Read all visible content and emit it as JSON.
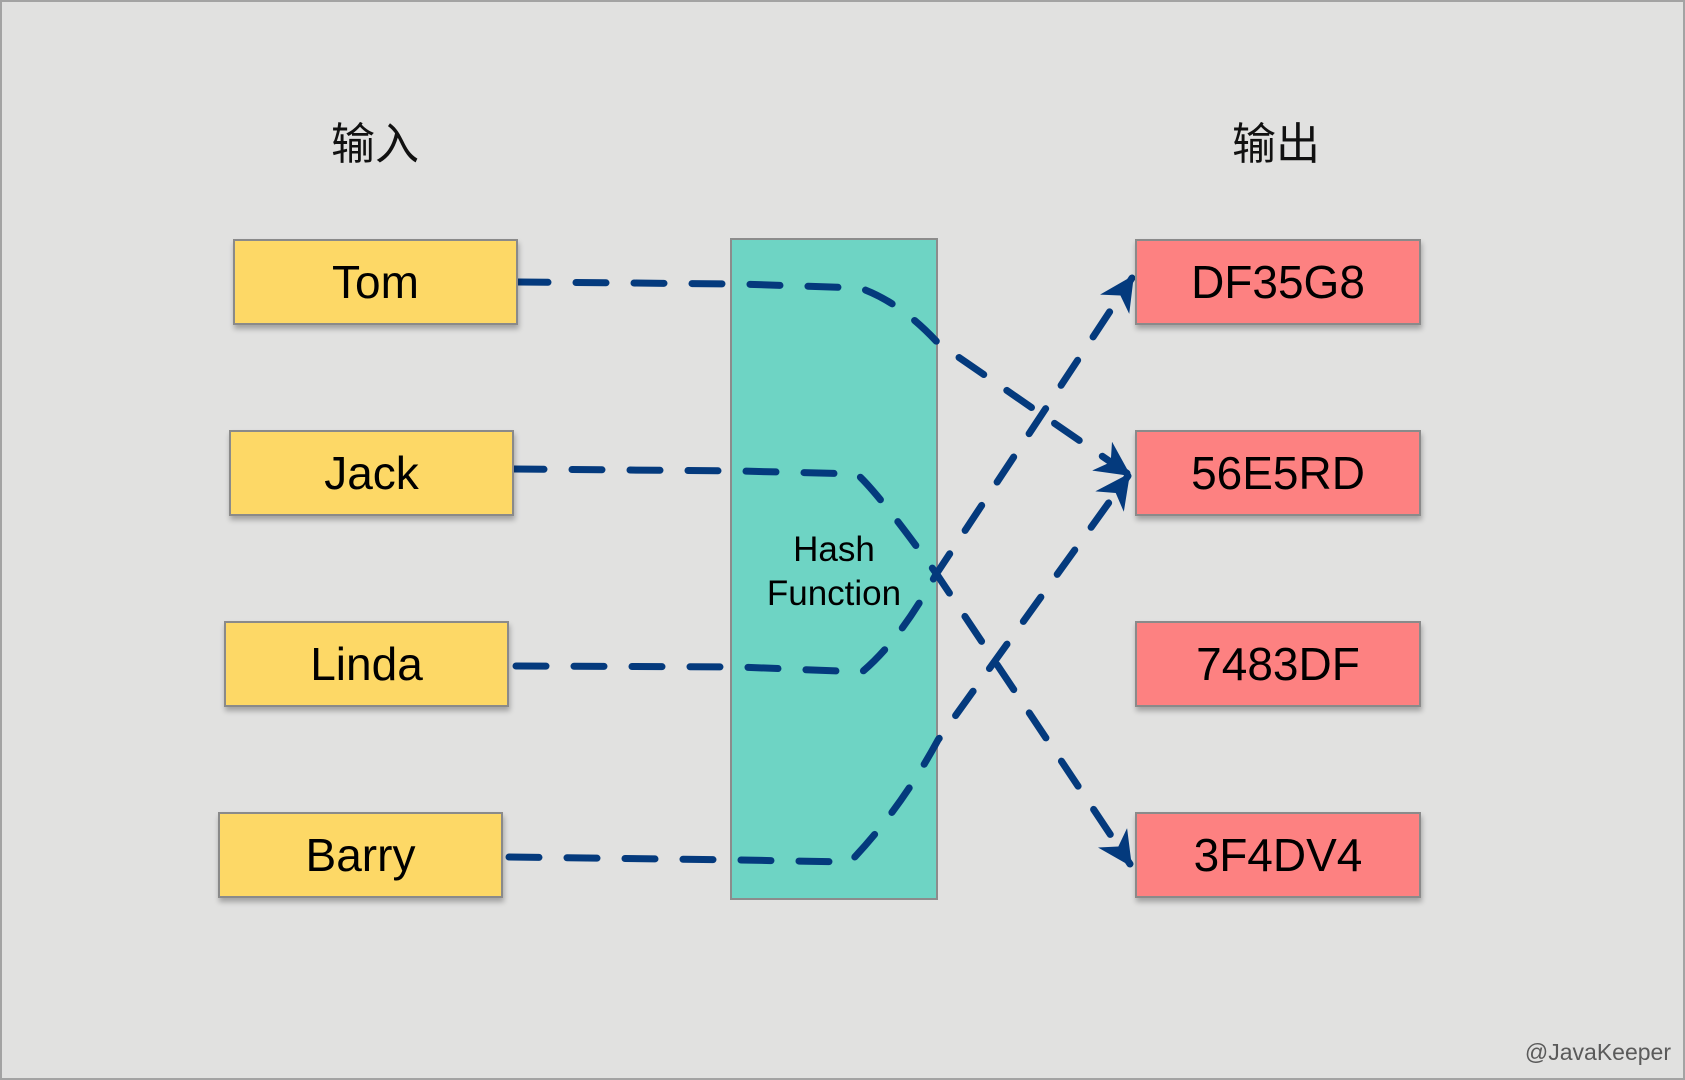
{
  "headings": {
    "input": "输入",
    "output": "输出"
  },
  "inputs": [
    "Tom",
    "Jack",
    "Linda",
    "Barry"
  ],
  "hash_function": {
    "line1": "Hash",
    "line2": "Function"
  },
  "outputs": [
    "DF35G8",
    "56E5RD",
    "7483DF",
    "3F4DV4"
  ],
  "mappings": [
    {
      "from": "Tom",
      "to": "56E5RD"
    },
    {
      "from": "Jack",
      "to": "3F4DV4"
    },
    {
      "from": "Linda",
      "to": "DF35G8"
    },
    {
      "from": "Barry",
      "to": "56E5RD"
    }
  ],
  "colors": {
    "background": "#e1e1e0",
    "input_box": "#fdd866",
    "output_box": "#fd8181",
    "hash_box": "#6ed4c4",
    "arrow": "#043a7d"
  },
  "watermark": "@JavaKeeper"
}
